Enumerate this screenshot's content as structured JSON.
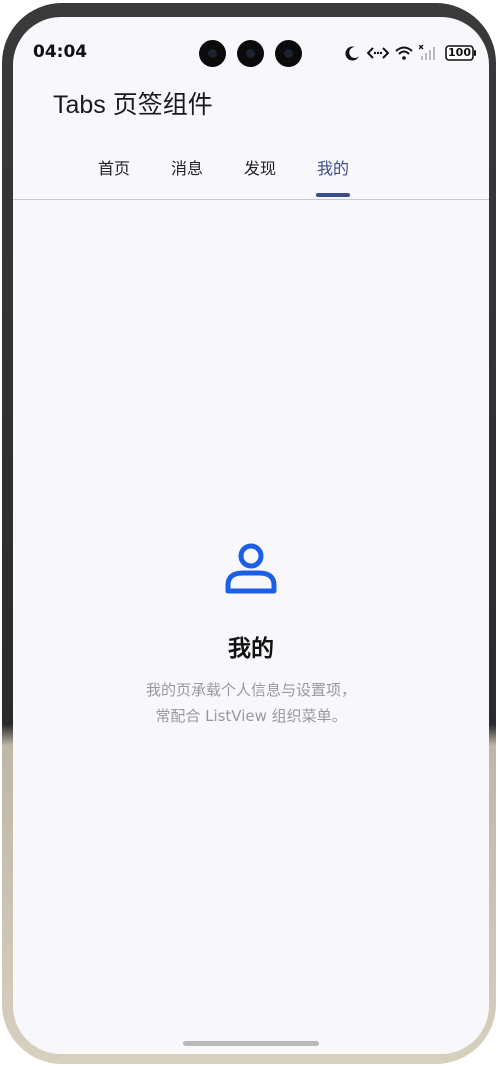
{
  "status_bar": {
    "time": "04:04",
    "battery": "100"
  },
  "app": {
    "title": "Tabs 页签组件"
  },
  "tabs": [
    {
      "label": "首页",
      "active": false
    },
    {
      "label": "消息",
      "active": false
    },
    {
      "label": "发现",
      "active": false
    },
    {
      "label": "我的",
      "active": true
    }
  ],
  "content": {
    "icon": "person-icon",
    "title": "我的",
    "description_line1": "我的页承载个人信息与设置项，",
    "description_line2": "常配合 ListView 组织菜单。"
  },
  "colors": {
    "accent": "#3b4d8f",
    "icon_blue": "#1a5fe6",
    "background": "#f8f7fc"
  }
}
